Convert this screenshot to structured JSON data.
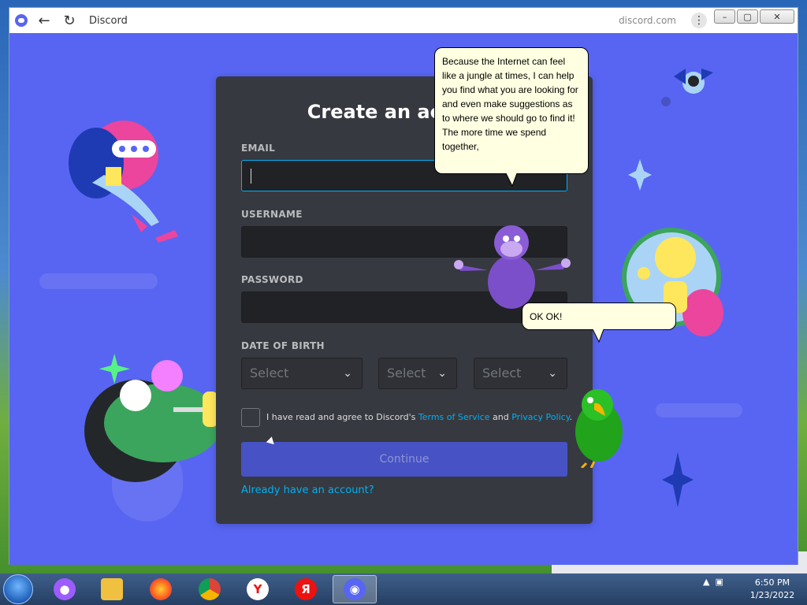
{
  "browser": {
    "title": "Discord",
    "url": "discord.com",
    "win_min": "–",
    "win_max": "▢",
    "win_close": "✕"
  },
  "form": {
    "title": "Create an account",
    "email_label": "EMAIL",
    "username_label": "USERNAME",
    "password_label": "PASSWORD",
    "dob_label": "DATE OF BIRTH",
    "select_month": "Select",
    "select_day": "Select",
    "select_year": "Select",
    "agree_prefix": "I have read and agree to Discord's ",
    "agree_tos": "Terms of Service",
    "agree_and": " and ",
    "agree_privacy": "Privacy Policy",
    "agree_suffix": ".",
    "continue_label": "Continue",
    "login_link": "Already have an account?"
  },
  "bubbles": {
    "big": "Because the Internet can feel like a jungle at times, I can help you find what you are looking for and even make suggestions as to where we should go to find it! The more time we spend together,",
    "small": "OK OK!"
  },
  "taskbar": {
    "time": "6:50 PM",
    "date": "1/23/2022"
  },
  "colors": {
    "discord_blurple": "#5865f2",
    "card_bg": "#36393f",
    "link": "#00aff4"
  }
}
